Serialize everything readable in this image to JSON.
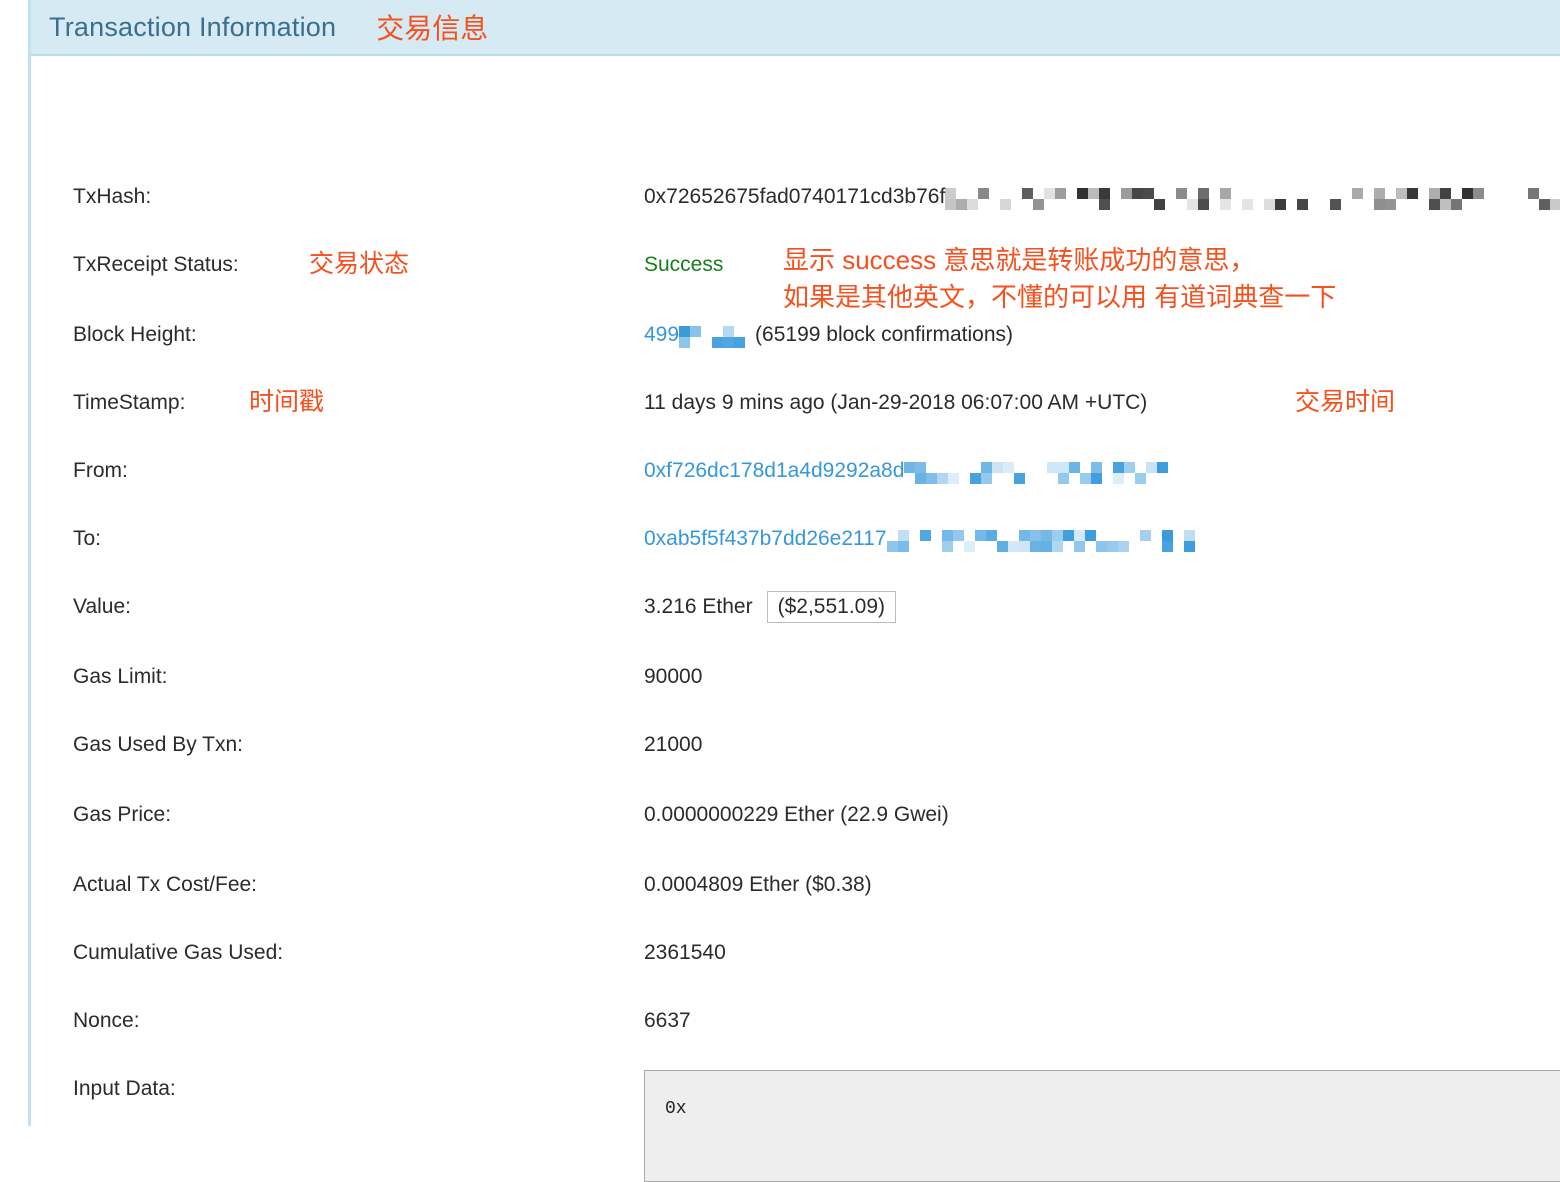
{
  "header": {
    "title": "Transaction Information",
    "annotation": "交易信息"
  },
  "rows": {
    "txhash": {
      "label": "TxHash:",
      "value": "0x72652675fad0740171cd3b76f"
    },
    "status": {
      "label": "TxReceipt Status:",
      "label_note": "交易状态",
      "value": "Success",
      "note_line1": "显示 success 意思就是转账成功的意思，",
      "note_line2": "如果是其他英文，不懂的可以用 有道词典查一下"
    },
    "block_height": {
      "label": "Block Height:",
      "value": "499",
      "confirmations": "(65199 block confirmations)"
    },
    "timestamp": {
      "label": "TimeStamp:",
      "label_note": "时间戳",
      "value": "11 days 9 mins ago (Jan-29-2018 06:07:00 AM +UTC)",
      "note": "交易时间"
    },
    "from": {
      "label": "From:",
      "value": "0xf726dc178d1a4d9292a8d"
    },
    "to": {
      "label": "To:",
      "value": "0xab5f5f437b7dd26e2117"
    },
    "value": {
      "label": "Value:",
      "value": "3.216 Ether",
      "usd": "($2,551.09)"
    },
    "gas_limit": {
      "label": "Gas Limit:",
      "value": "90000"
    },
    "gas_used": {
      "label": "Gas Used By Txn:",
      "value": "21000"
    },
    "gas_price": {
      "label": "Gas Price:",
      "value": "0.0000000229 Ether (22.9 Gwei)"
    },
    "tx_fee": {
      "label": "Actual Tx Cost/Fee:",
      "value": "0.0004809 Ether ($0.38)"
    },
    "cumulative_gas": {
      "label": "Cumulative Gas Used:",
      "value": "2361540"
    },
    "nonce": {
      "label": "Nonce:",
      "value": "6637"
    },
    "input_data": {
      "label": "Input Data:",
      "value": "0x"
    }
  },
  "colors": {
    "header_bg": "#d6eaf4",
    "header_text": "#3a6f8f",
    "annotation": "#f4511e",
    "link": "#3498db",
    "success": "#18801a",
    "text": "#2b2b2b"
  }
}
